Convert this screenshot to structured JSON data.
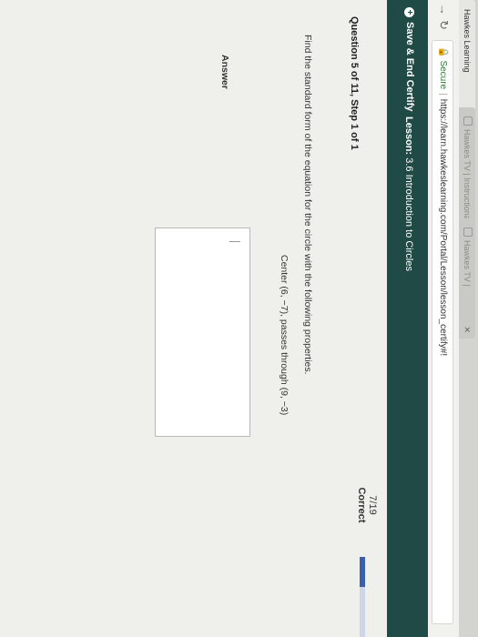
{
  "browser": {
    "tabs": [
      {
        "label": "Hawkes Learning",
        "active": true
      },
      {
        "label": "Hawkes TV | Instructional",
        "active": false
      },
      {
        "label": "Hawkes TV | Instructional",
        "active": false
      }
    ],
    "address": {
      "secure_label": "Secure",
      "url": "https://learn.hawkeslearning.com/Portal/Lesson/lesson_certify#!"
    }
  },
  "header": {
    "save_label": "Save & End Certify",
    "lesson_prefix": "Lesson:",
    "lesson_title": "3.6 Introduction to Circles"
  },
  "question": {
    "heading": "Question 5 of 11, Step 1 of 1",
    "prompt": "Find the standard form of the equation for the circle with the following properties.",
    "properties": "Center (6, −7), passes through (9, −3)"
  },
  "score": {
    "fraction": "7/19",
    "status": "Correct",
    "progress_fraction": 0.37
  },
  "answer": {
    "label": "Answer",
    "value": ""
  },
  "colors": {
    "header_bg": "#1f4a45",
    "progress_fill": "#3b5fa8",
    "secure_green": "#2e7d32"
  }
}
